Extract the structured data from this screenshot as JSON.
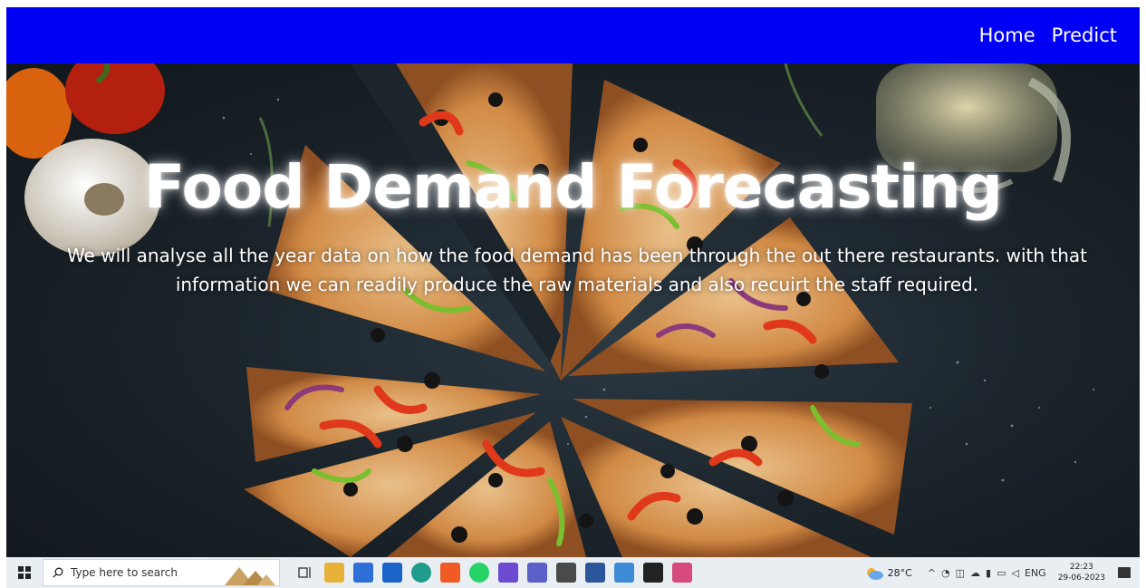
{
  "nav": {
    "items": [
      {
        "label": "Home"
      },
      {
        "label": "Predict"
      }
    ],
    "color": "#0000f5"
  },
  "hero": {
    "title": "Food Demand Forecasting",
    "description": "We will analyse all the year data on how the food demand has been through the out there restaurants. with that information we can readily produce the raw materials and also recuirt the staff required."
  },
  "taskbar": {
    "search_placeholder": "Type here to search",
    "weather": "28°C",
    "language": "ENG",
    "time": "22:23",
    "date": "29-06-2023",
    "apps": [
      {
        "icon": "task-view-icon",
        "color": "#3b3b3b"
      },
      {
        "icon": "file-explorer-icon",
        "color": "#e8b23a"
      },
      {
        "icon": "store-icon",
        "color": "#2d6fd6"
      },
      {
        "icon": "mail-icon",
        "color": "#1a64c8"
      },
      {
        "icon": "edge-icon",
        "color": "#1f9c8a"
      },
      {
        "icon": "brave-icon",
        "color": "#f05a24"
      },
      {
        "icon": "whatsapp-icon",
        "color": "#25d366"
      },
      {
        "icon": "paint-icon",
        "color": "#6c4bd1"
      },
      {
        "icon": "teams-icon",
        "color": "#5b5fc7"
      },
      {
        "icon": "calculator-icon",
        "color": "#4a4a4a"
      },
      {
        "icon": "word-icon",
        "color": "#2b579a"
      },
      {
        "icon": "installer-icon",
        "color": "#3d8bd4"
      },
      {
        "icon": "terminal-icon",
        "color": "#222222"
      },
      {
        "icon": "snipping-tool-icon",
        "color": "#d64a7d"
      }
    ]
  }
}
